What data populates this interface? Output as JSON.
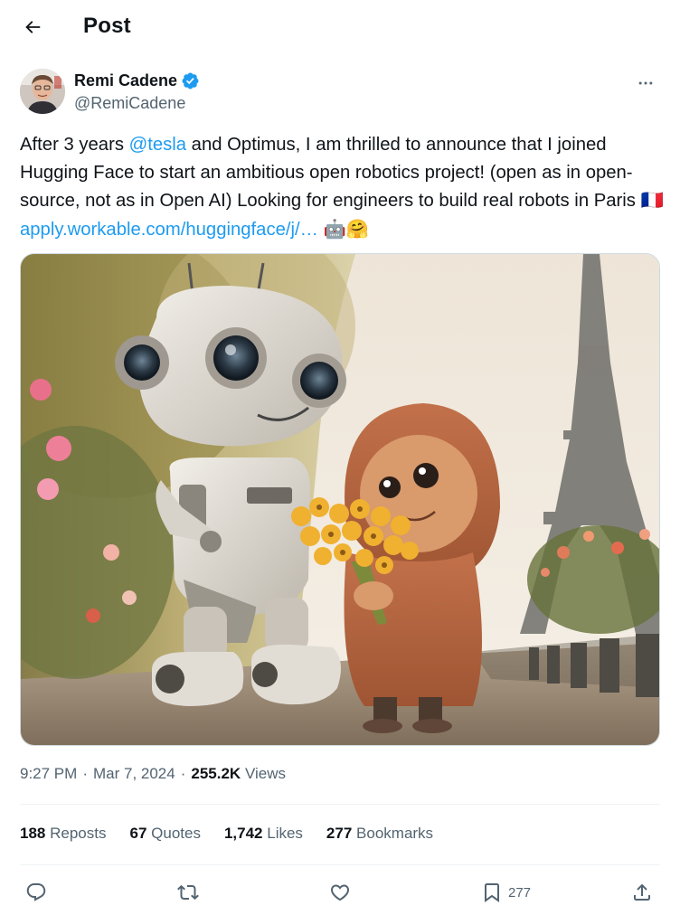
{
  "header": {
    "title": "Post",
    "back_icon": "arrow-left-icon"
  },
  "author": {
    "name": "Remi Cadene",
    "handle": "@RemiCadene",
    "verified_color": "#1d9bf0",
    "more_icon": "more-horizontal-icon"
  },
  "tweet": {
    "text_1": "After 3 years ",
    "mention": "@tesla",
    "text_2": " and Optimus, I am thrilled to announce that I joined Hugging Face to start an ambitious open robotics project! (open as in open-source, not as in Open AI) Looking for engineers to build real robots in Paris ",
    "flag": "🇫🇷",
    "link": "apply.workable.com/huggingface/j/…",
    "emojis": "🤖🤗",
    "link_color": "#1d9bf0"
  },
  "media": {
    "description_icon": "photo-icon"
  },
  "meta": {
    "time": "9:27 PM",
    "separator": "·",
    "date": "Mar 7, 2024",
    "views_count": "255.2K",
    "views_label": "Views"
  },
  "stats": [
    {
      "count": "188",
      "label": "Reposts"
    },
    {
      "count": "67",
      "label": "Quotes"
    },
    {
      "count": "1,742",
      "label": "Likes"
    },
    {
      "count": "277",
      "label": "Bookmarks"
    }
  ],
  "actions": {
    "reply_icon": "reply-icon",
    "repost_icon": "repost-icon",
    "like_icon": "heart-icon",
    "bookmark_icon": "bookmark-icon",
    "bookmark_count": "277",
    "share_icon": "share-icon"
  }
}
